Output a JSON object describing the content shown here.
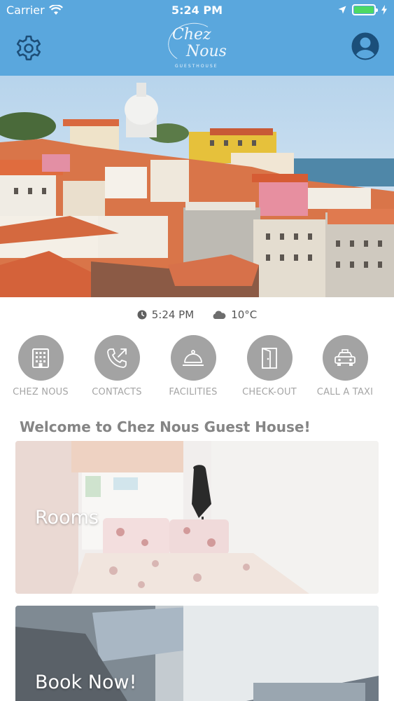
{
  "status_bar": {
    "carrier": "Carrier",
    "time": "5:24 PM"
  },
  "header": {
    "logo_line1": "Chez",
    "logo_line2": "Nous",
    "logo_tagline": "GUESTHOUSE"
  },
  "info": {
    "time": "5:24 PM",
    "temperature": "10°C"
  },
  "actions": [
    {
      "label": "CHEZ NOUS",
      "icon": "building-icon"
    },
    {
      "label": "CONTACTS",
      "icon": "phone-outgoing-icon"
    },
    {
      "label": "FACILITIES",
      "icon": "service-bell-icon"
    },
    {
      "label": "CHECK-OUT",
      "icon": "door-exit-icon"
    },
    {
      "label": "CALL A TAXI",
      "icon": "taxi-icon"
    }
  ],
  "welcome": "Welcome to Chez Nous Guest House!",
  "cards": [
    {
      "title": "Rooms"
    },
    {
      "title": "Book Now!"
    }
  ],
  "colors": {
    "header": "#5aa7dd",
    "action_circle": "#a3a3a3",
    "action_label": "#a5a5a5",
    "battery": "#4cd964"
  }
}
